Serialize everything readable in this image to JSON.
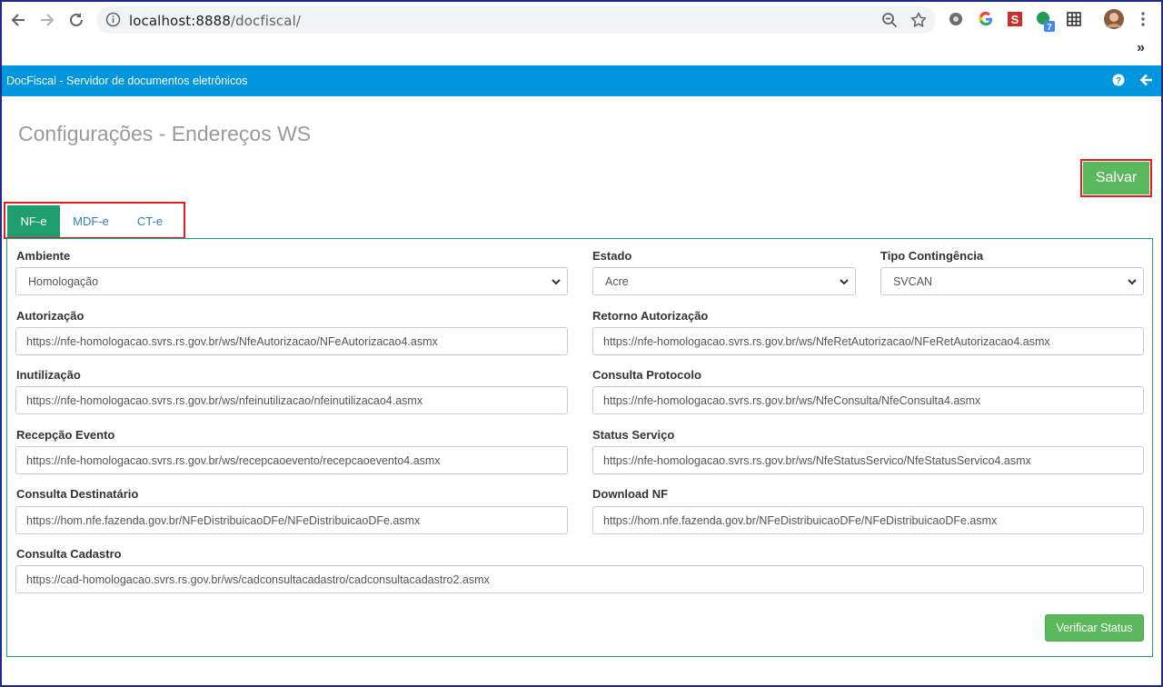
{
  "browser": {
    "url_host": "localhost:8888",
    "url_path": "/docfiscal/",
    "ext_badge": "7",
    "overflow": "»"
  },
  "app": {
    "title": "DocFiscal - Servidor de documentos eletrônicos"
  },
  "page": {
    "title": "Configurações - Endereços WS",
    "save_label": "Salvar",
    "verify_label": "Verificar Status"
  },
  "tabs": [
    {
      "label": "NF-e",
      "active": true
    },
    {
      "label": "MDF-e",
      "active": false
    },
    {
      "label": "CT-e",
      "active": false
    }
  ],
  "form": {
    "ambiente": {
      "label": "Ambiente",
      "value": "Homologação"
    },
    "estado": {
      "label": "Estado",
      "value": "Acre"
    },
    "contingencia": {
      "label": "Tipo Contingência",
      "value": "SVCAN"
    },
    "autorizacao": {
      "label": "Autorização",
      "value": "https://nfe-homologacao.svrs.rs.gov.br/ws/NfeAutorizacao/NFeAutorizacao4.asmx"
    },
    "retorno": {
      "label": "Retorno Autorização",
      "value": "https://nfe-homologacao.svrs.rs.gov.br/ws/NfeRetAutorizacao/NFeRetAutorizacao4.asmx"
    },
    "inutilizacao": {
      "label": "Inutilização",
      "value": "https://nfe-homologacao.svrs.rs.gov.br/ws/nfeinutilizacao/nfeinutilizacao4.asmx"
    },
    "consulta_protocolo": {
      "label": "Consulta Protocolo",
      "value": "https://nfe-homologacao.svrs.rs.gov.br/ws/NfeConsulta/NfeConsulta4.asmx"
    },
    "recepcao_evento": {
      "label": "Recepção Evento",
      "value": "https://nfe-homologacao.svrs.rs.gov.br/ws/recepcaoevento/recepcaoevento4.asmx"
    },
    "status_servico": {
      "label": "Status Serviço",
      "value": "https://nfe-homologacao.svrs.rs.gov.br/ws/NfeStatusServico/NfeStatusServico4.asmx"
    },
    "consulta_destinatario": {
      "label": "Consulta Destinatário",
      "value": "https://hom.nfe.fazenda.gov.br/NFeDistribuicaoDFe/NFeDistribuicaoDFe.asmx"
    },
    "download_nf": {
      "label": "Download NF",
      "value": "https://hom.nfe.fazenda.gov.br/NFeDistribuicaoDFe/NFeDistribuicaoDFe.asmx"
    },
    "consulta_cadastro": {
      "label": "Consulta Cadastro",
      "value": "https://cad-homologacao.svrs.rs.gov.br/ws/cadconsultacadastro/cadconsultacadastro2.asmx"
    }
  },
  "colors": {
    "appbar": "#0096dd",
    "tab_active": "#1e9e6e",
    "button": "#5cb85c",
    "highlight": "#e02020"
  }
}
